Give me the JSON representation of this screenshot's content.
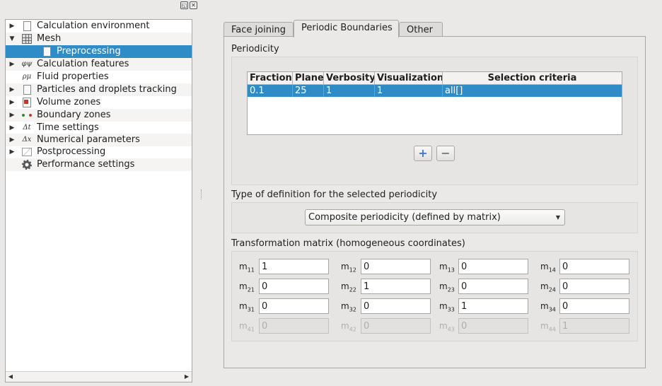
{
  "tree": {
    "items": [
      {
        "label": "Calculation environment",
        "icon": "document-icon",
        "expandable": true
      },
      {
        "label": "Mesh",
        "icon": "grid-icon",
        "expandable": true,
        "expanded": true
      },
      {
        "label": "Preprocessing",
        "icon": "document-icon",
        "selected": true,
        "child": true
      },
      {
        "label": "Calculation features",
        "icon": "phi-icon",
        "expandable": true,
        "glyph": "φψ"
      },
      {
        "label": "Fluid properties",
        "icon": "rho-mu-icon",
        "glyph": "ρμ"
      },
      {
        "label": "Particles and droplets tracking",
        "icon": "document-icon",
        "expandable": true
      },
      {
        "label": "Volume zones",
        "icon": "volume-icon",
        "expandable": true
      },
      {
        "label": "Boundary zones",
        "icon": "boundary-icon",
        "expandable": true
      },
      {
        "label": "Time settings",
        "icon": "delta-t-icon",
        "expandable": true,
        "glyph": "Δt"
      },
      {
        "label": "Numerical parameters",
        "icon": "delta-x-icon",
        "expandable": true,
        "glyph": "Δx"
      },
      {
        "label": "Postprocessing",
        "icon": "chart-icon",
        "expandable": true
      },
      {
        "label": "Performance settings",
        "icon": "gear-icon"
      }
    ]
  },
  "tabs": [
    {
      "label": "Face joining",
      "active": false
    },
    {
      "label": "Periodic Boundaries",
      "active": true
    },
    {
      "label": "Other",
      "active": false
    }
  ],
  "periodicity": {
    "title": "Periodicity",
    "columns": [
      "Fraction",
      "Plane",
      "Verbosity",
      "Visualization",
      "Selection criteria"
    ],
    "rows": [
      {
        "fraction": "0.1",
        "plane": "25",
        "verbosity": "1",
        "visualization": "1",
        "selection": "all[]"
      }
    ],
    "add_label": "+",
    "remove_label": "−"
  },
  "definition": {
    "title": "Type of definition for the selected periodicity",
    "selected": "Composite periodicity (defined by matrix)"
  },
  "matrix": {
    "title": "Transformation matrix (homogeneous coordinates)",
    "rows": [
      [
        {
          "name": "m",
          "sub": "11",
          "value": "1"
        },
        {
          "name": "m",
          "sub": "12",
          "value": "0"
        },
        {
          "name": "m",
          "sub": "13",
          "value": "0"
        },
        {
          "name": "m",
          "sub": "14",
          "value": "0"
        }
      ],
      [
        {
          "name": "m",
          "sub": "21",
          "value": "0"
        },
        {
          "name": "m",
          "sub": "22",
          "value": "1"
        },
        {
          "name": "m",
          "sub": "23",
          "value": "0"
        },
        {
          "name": "m",
          "sub": "24",
          "value": "0"
        }
      ],
      [
        {
          "name": "m",
          "sub": "31",
          "value": "0"
        },
        {
          "name": "m",
          "sub": "32",
          "value": "0"
        },
        {
          "name": "m",
          "sub": "33",
          "value": "1"
        },
        {
          "name": "m",
          "sub": "34",
          "value": "0"
        }
      ],
      [
        {
          "name": "m",
          "sub": "41",
          "value": "0",
          "disabled": true
        },
        {
          "name": "m",
          "sub": "42",
          "value": "0",
          "disabled": true
        },
        {
          "name": "m",
          "sub": "43",
          "value": "0",
          "disabled": true
        },
        {
          "name": "m",
          "sub": "44",
          "value": "1",
          "disabled": true
        }
      ]
    ]
  },
  "colors": {
    "selection": "#308cc6",
    "background": "#ebe9e7"
  }
}
